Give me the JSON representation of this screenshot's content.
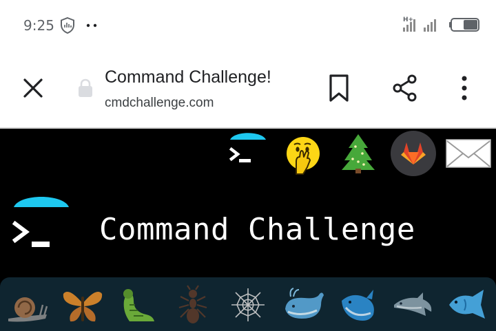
{
  "status_bar": {
    "time": "9:25",
    "network_label": "H+",
    "icons": [
      "shield-icon",
      "more-dots-icon",
      "signal-icon",
      "battery-icon"
    ]
  },
  "toolbar": {
    "title": "Command Challenge!",
    "url": "cmdchallenge.com",
    "icons": [
      "close-icon",
      "lock-icon",
      "bookmark-icon",
      "share-icon",
      "more-vert-icon"
    ]
  },
  "page": {
    "hero_title": "Command Challenge",
    "nav_icons": [
      "terminal-logo-icon",
      "hand-over-mouth-emoji-icon",
      "christmas-tree-icon",
      "gitlab-icon",
      "mail-icon"
    ],
    "creature_icons": [
      "snail-icon",
      "butterfly-icon",
      "bug-icon",
      "ant-icon",
      "spider-web-icon",
      "whale-icon",
      "spouting-whale-icon",
      "dolphin-icon",
      "fish-icon"
    ],
    "colors": {
      "background": "#000000",
      "accent_cyan": "#1ec8f0",
      "creature_strip": "#0f2530"
    }
  }
}
